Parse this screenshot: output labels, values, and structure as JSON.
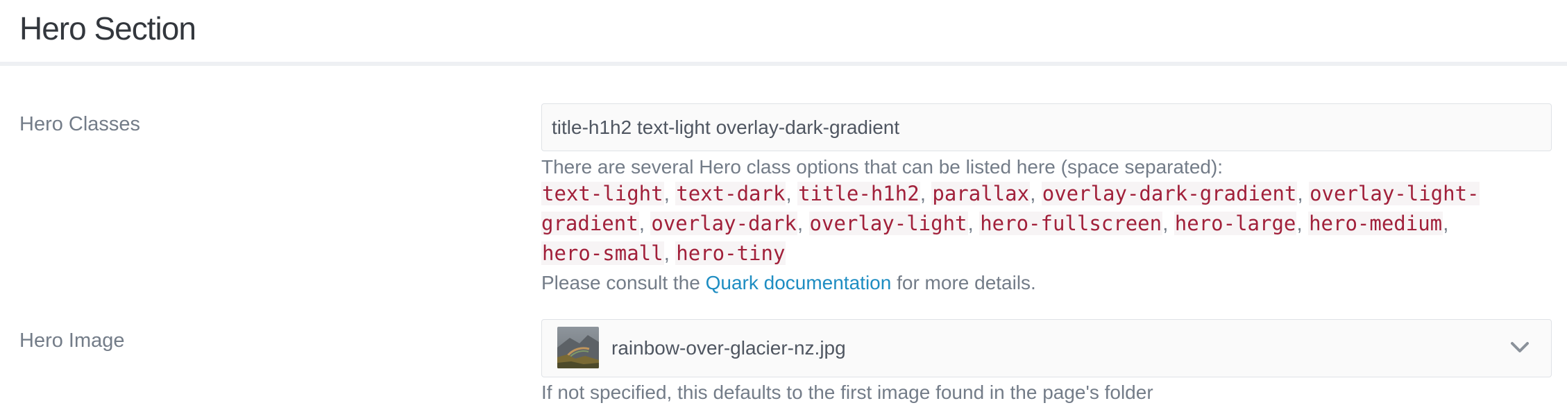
{
  "header": {
    "title": "Hero Section"
  },
  "hero_classes": {
    "label": "Hero Classes",
    "value": "title-h1h2 text-light overlay-dark-gradient",
    "help_intro": "There are several Hero class options that can be listed here (space separated):",
    "options": [
      "text-light",
      "text-dark",
      "title-h1h2",
      "parallax",
      "overlay-dark-gradient",
      "overlay-light-gradient",
      "overlay-dark",
      "overlay-light",
      "hero-fullscreen",
      "hero-large",
      "hero-medium",
      "hero-small",
      "hero-tiny"
    ],
    "consult_prefix": "Please consult the",
    "consult_link": "Quark documentation",
    "consult_suffix": "for more details."
  },
  "hero_image": {
    "label": "Hero Image",
    "selected": "rainbow-over-glacier-nz.jpg",
    "thumbnail_icon": "image-thumbnail",
    "dropdown_icon": "chevron-down-icon",
    "help": "If not specified, this defaults to the first image found in the page's folder"
  },
  "colors": {
    "code_text": "#a1203a",
    "link": "#1e8dc2",
    "label": "#737c88"
  }
}
